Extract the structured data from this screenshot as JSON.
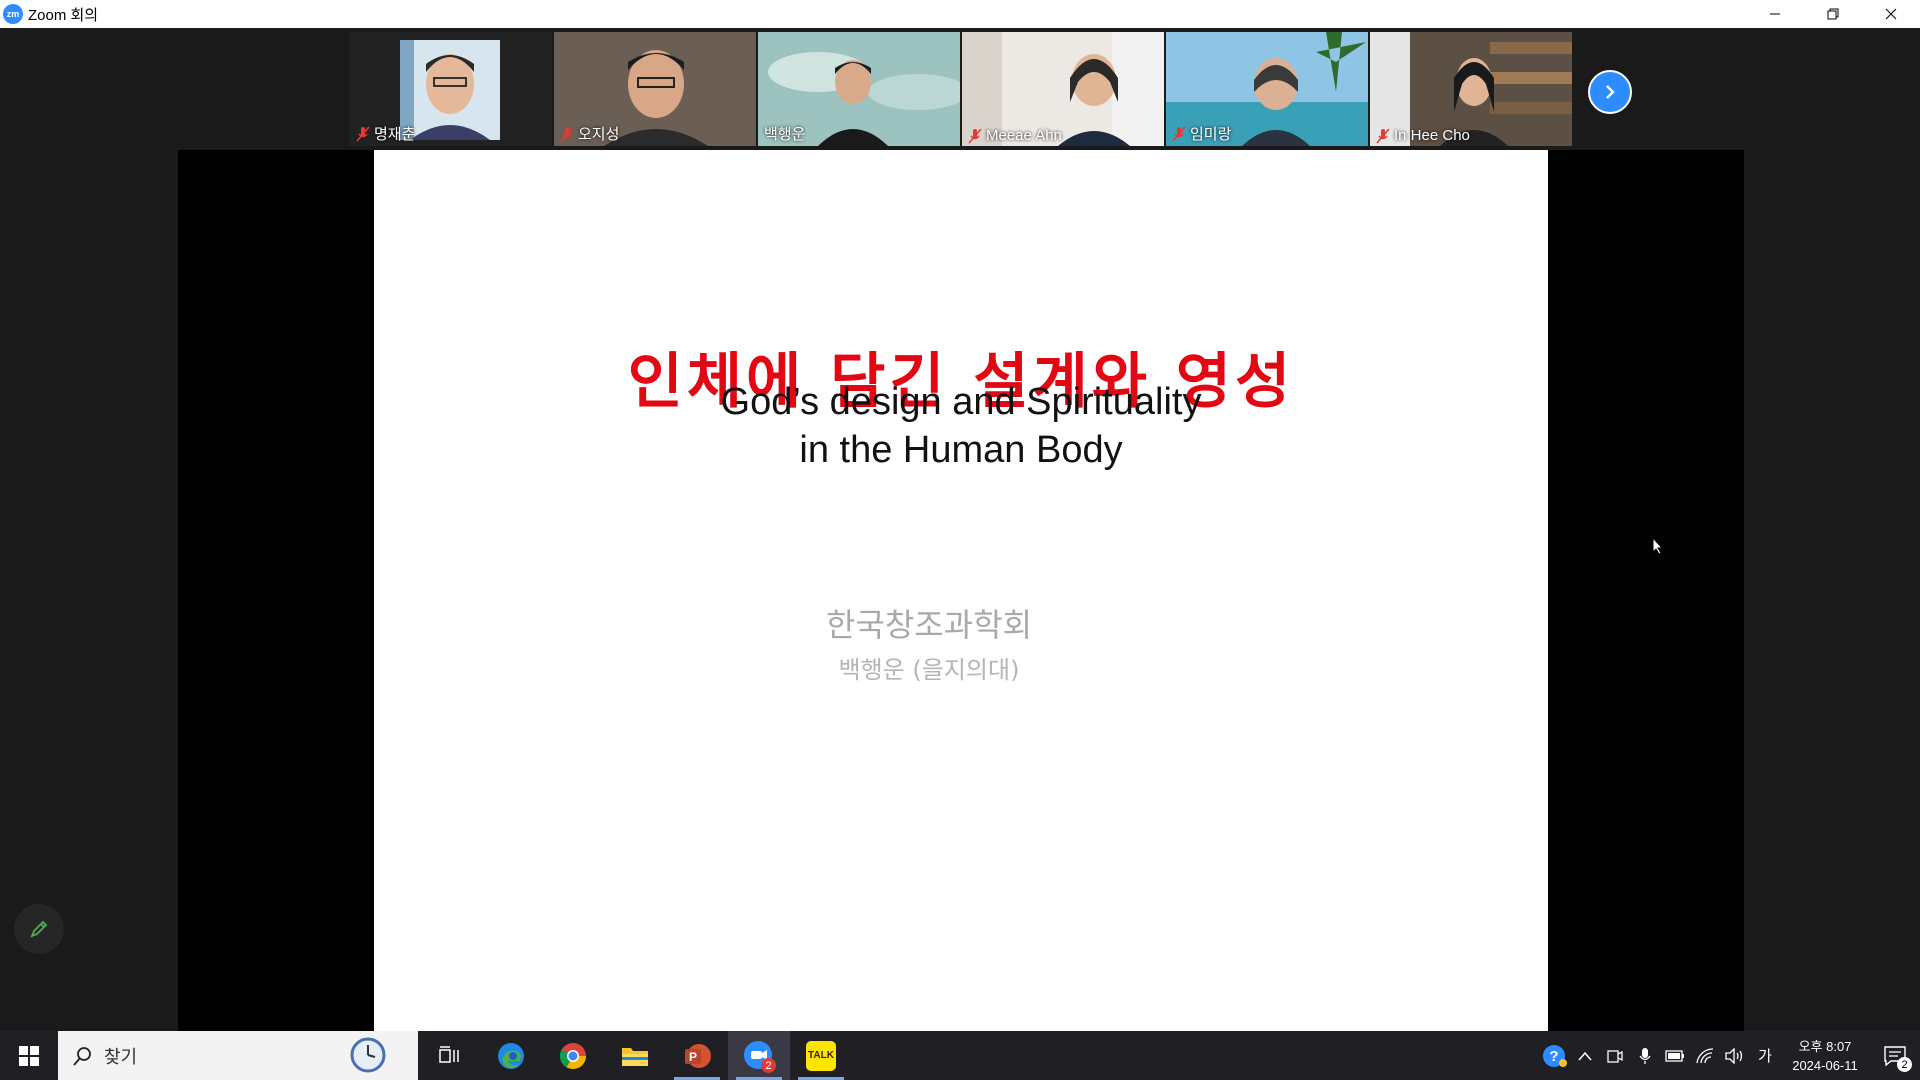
{
  "window": {
    "title": "Zoom 회의"
  },
  "participants": [
    {
      "name": "명재춘",
      "muted": true
    },
    {
      "name": "오지성",
      "muted": true
    },
    {
      "name": "백행운",
      "muted": false,
      "active_speaker": true
    },
    {
      "name": "Meeae Ahn",
      "muted": true
    },
    {
      "name": "임미랑",
      "muted": true
    },
    {
      "name": "In Hee Cho",
      "muted": true
    }
  ],
  "slide": {
    "title_ko": "인체에 담긴 설계와 영성",
    "title_en_line1": "God’s design and Spirituality",
    "title_en_line2": "in the Human Body",
    "org": "한국창조과학회",
    "author": "백행운 (을지의대)"
  },
  "taskbar": {
    "search_placeholder": "찾기",
    "zoom_badge": "2",
    "kakao_label": "TALK",
    "ime_indicator": "가",
    "time": "오후 8:07",
    "date": "2024-06-11",
    "notification_count": "2"
  },
  "colors": {
    "zoom_blue": "#2d8cff",
    "slide_title_red": "#e30613",
    "active_speaker": "#9fd96b"
  }
}
